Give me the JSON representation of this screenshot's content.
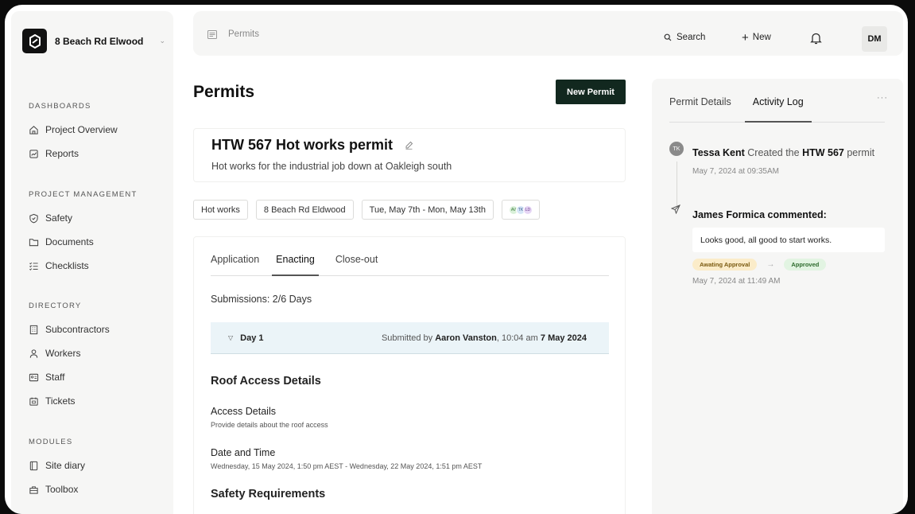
{
  "sidebar": {
    "project_name": "8 Beach Rd Elwood",
    "sections": [
      {
        "heading": "DASHBOARDS",
        "items": [
          {
            "label": "Project Overview",
            "icon": "home-icon"
          },
          {
            "label": "Reports",
            "icon": "chart-icon"
          }
        ]
      },
      {
        "heading": "PROJECT MANAGEMENT",
        "items": [
          {
            "label": "Safety",
            "icon": "shield-icon"
          },
          {
            "label": "Documents",
            "icon": "folder-icon"
          },
          {
            "label": "Checklists",
            "icon": "checklist-icon"
          }
        ]
      },
      {
        "heading": "DIRECTORY",
        "items": [
          {
            "label": "Subcontractors",
            "icon": "building-icon"
          },
          {
            "label": "Workers",
            "icon": "person-icon"
          },
          {
            "label": "Staff",
            "icon": "id-card-icon"
          },
          {
            "label": "Tickets",
            "icon": "ticket-icon"
          }
        ]
      },
      {
        "heading": "MODULES",
        "items": [
          {
            "label": "Site diary",
            "icon": "book-icon"
          },
          {
            "label": "Toolbox",
            "icon": "toolbox-icon"
          }
        ]
      }
    ]
  },
  "topbar": {
    "breadcrumb": "Permits",
    "search_label": "Search",
    "new_label": "New",
    "avatar_initials": "DM"
  },
  "main": {
    "page_title": "Permits",
    "new_permit_label": "New Permit",
    "permit": {
      "title": "HTW 567 Hot works permit",
      "subtitle": "Hot works for the industrial job down at Oakleigh south"
    },
    "tags": [
      "Hot works",
      "8 Beach Rd Eldwood",
      "Tue, May 7th - Mon, May 13th"
    ],
    "assignees": [
      {
        "initials": "AV",
        "color": "#d9f0d9"
      },
      {
        "initials": "TK",
        "color": "#d6e6f7"
      },
      {
        "initials": "LD",
        "color": "#e6d6f5"
      }
    ],
    "tabs": [
      "Application",
      "Enacting",
      "Close-out"
    ],
    "active_tab": "Enacting",
    "submissions": "Submissions: 2/6 Days",
    "day": {
      "label": "Day 1",
      "submitted_prefix": "Submitted by",
      "submitted_by": "Aaron Vanston",
      "time": ", 10:04 am",
      "date": "7 May 2024"
    },
    "sections": {
      "roof_heading": "Roof Access Details",
      "access_label": "Access Details",
      "access_desc": "Provide details about the roof access",
      "datetime_label": "Date and Time",
      "datetime_desc": "Wednesday, 15 May 2024, 1:50 pm AEST - Wednesday, 22 May 2024, 1:51 pm AEST",
      "safety_heading": "Safety Requirements"
    }
  },
  "activity": {
    "tabs": [
      "Permit Details",
      "Activity Log"
    ],
    "active_tab": "Activity Log",
    "entries": [
      {
        "avatar": "TK",
        "name": "Tessa Kent",
        "action": "Created the",
        "object": "HTW 567",
        "suffix": "permit",
        "time": "May 7, 2024 at 09:35AM"
      },
      {
        "name": "James Formica",
        "action": "commented:",
        "comment": "Looks good, all good to start works.",
        "status_from": "Awating Approval",
        "status_to": "Approved",
        "time": "May 7, 2024 at 11:49 AM"
      }
    ]
  }
}
